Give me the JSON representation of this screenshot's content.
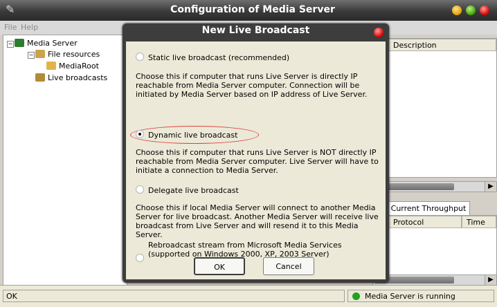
{
  "window": {
    "title": "Configuration of Media Server",
    "menu": [
      "File",
      "Help"
    ]
  },
  "tree": {
    "items": [
      {
        "label": "Media Server",
        "icon": "media-server-icon"
      },
      {
        "label": "File resources",
        "icon": "file-resources-icon"
      },
      {
        "label": "MediaRoot",
        "icon": "folder-icon"
      },
      {
        "label": "Live broadcasts",
        "icon": "live-broadcasts-icon"
      }
    ]
  },
  "right_pane": {
    "columns": [
      "Description"
    ],
    "tab": "Current Throughput",
    "lower_columns": [
      "Protocol",
      "Time"
    ]
  },
  "status": {
    "left": "OK",
    "right": "Media Server is running",
    "dot_color": "#1fa31f"
  },
  "dialog": {
    "title": "New Live Broadcast",
    "options": [
      {
        "label": "Static live broadcast (recommended)",
        "checked": false,
        "desc": [
          "Choose this if computer that runs Live Server is directly IP",
          "reachable from Media Server computer. Connection will be",
          "initiated by Media Server based on IP address of Live Server."
        ]
      },
      {
        "label": "Dynamic live broadcast",
        "checked": true,
        "desc": [
          "Choose this if computer that runs Live Server is NOT directly IP",
          "reachable from Media Server computer. Live Server will have to",
          "initiate a connection to Media Server."
        ]
      },
      {
        "label": "Delegate live broadcast",
        "checked": false,
        "desc": [
          "Choose this if local Media Server will connect to another Media",
          "Server for live broadcast. Another Media Server will receive live",
          "broadcast from Live Server and will resend it to this Media Server."
        ]
      },
      {
        "label_lines": [
          "Rebroadcast stream from Microsoft Media Services",
          "(supported on Windows 2000, XP, 2003 Server)"
        ],
        "checked": false
      }
    ],
    "ok": "OK",
    "cancel": "Cancel"
  }
}
